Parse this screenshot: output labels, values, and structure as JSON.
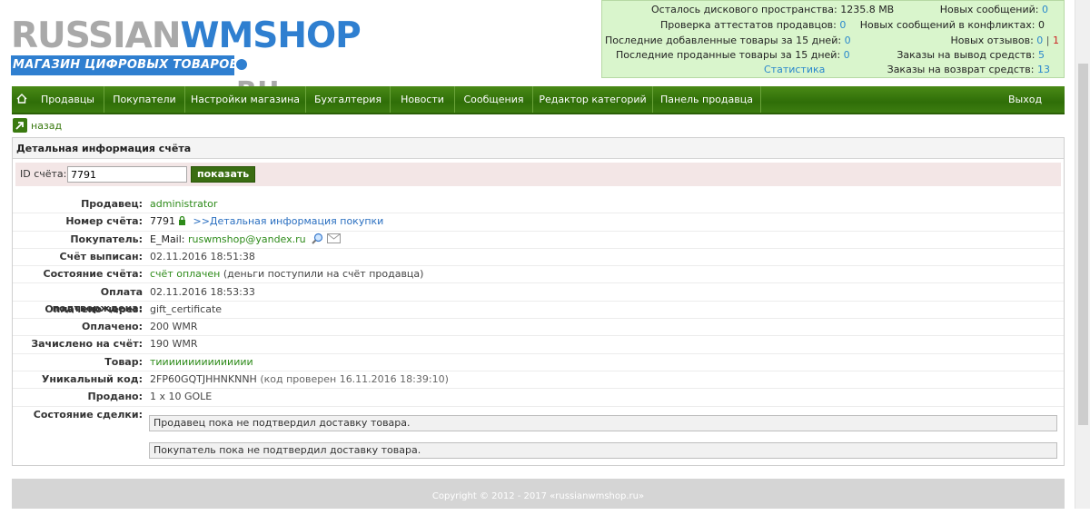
{
  "logo": {
    "top_gray": "RUSSIAN",
    "top_blue": "WMSHOP",
    "band": "МАГАЗИН ЦИФРОВЫХ ТОВАРОВ",
    "ru": "RU"
  },
  "stats": {
    "disk_label": "Осталось дискового пространства:",
    "disk_value": "1235.8 MB",
    "cert_label": "Проверка аттестатов продавцов:",
    "cert_value": "0",
    "added_label": "Последние добавленные товары за 15 дней:",
    "added_value": "0",
    "sold_label": "Последние проданные товары за 15 дней:",
    "sold_value": "0",
    "statistics_link": "Статистика",
    "new_msgs_label": "Новых сообщений:",
    "new_msgs_value": "0",
    "conflict_label": "Новых сообщений в конфликтах:",
    "conflict_value": "0",
    "reviews_label": "Новых отзывов:",
    "reviews_value_a": "0",
    "reviews_sep": "|",
    "reviews_value_b": "1",
    "withdraw_label": "Заказы на вывод средств:",
    "withdraw_value": "5",
    "refund_label": "Заказы на возврат средств:",
    "refund_value": "13"
  },
  "nav": {
    "items": [
      "Продавцы",
      "Покупатели",
      "Настройки магазина",
      "Бухгалтерия",
      "Новости",
      "Сообщения",
      "Редактор категорий",
      "Панель продавца"
    ],
    "exit": "Выход"
  },
  "back": "назад",
  "panel": {
    "title": "Детальная информация счёта",
    "search_label": "ID счёта:",
    "search_value": "7791",
    "search_button": "показать"
  },
  "details": {
    "seller_k": "Продавец:",
    "seller_v": "administrator",
    "invoice_k": "Номер счёта:",
    "invoice_v": "7791",
    "invoice_link": ">>Детальная информация покупки",
    "buyer_k": "Покупатель:",
    "buyer_prefix": "E_Mail:",
    "buyer_email": "ruswmshop@yandex.ru",
    "issued_k": "Счёт выписан:",
    "issued_v": "02.11.2016 18:51:38",
    "state_k": "Состояние счёта:",
    "state_v": "счёт оплачен",
    "state_note": "(деньги поступили на счёт продавца)",
    "confirmed_k": "Оплата подтверждена:",
    "confirmed_v": "02.11.2016 18:53:33",
    "paidvia_k": "Оплачено через:",
    "paidvia_v": "gift_certificate",
    "paid_k": "Оплачено:",
    "paid_v": "200 WMR",
    "credited_k": "Зачислено на счёт:",
    "credited_v": "190 WMR",
    "product_k": "Товар:",
    "product_v": "тиииииииииииииии",
    "code_k": "Уникальный код:",
    "code_v": "2FP60GQTJHHNKNNH",
    "code_note": "(код проверен 16.11.2016 18:39:10)",
    "sold_k": "Продано:",
    "sold_v": "1 x 10 GOLE",
    "deal_k": "Состояние сделки:",
    "deal_seller": "Продавец пока не подтвердил доставку товара.",
    "deal_buyer": "Покупатель пока не подтвердил доставку товара."
  },
  "footer": "Copyright © 2012 - 2017 «russianwmshop.ru»"
}
